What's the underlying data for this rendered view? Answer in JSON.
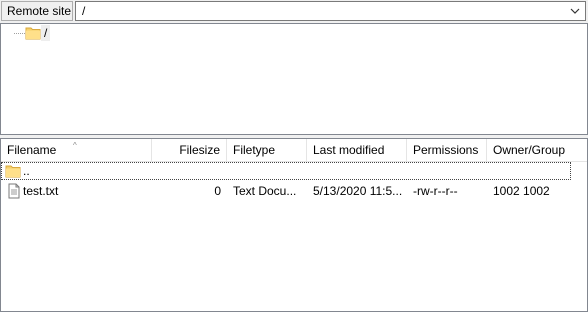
{
  "site_bar": {
    "label": "Remote site:",
    "path": "/"
  },
  "tree": {
    "root_label": "/"
  },
  "file_list": {
    "columns": [
      {
        "key": "filename",
        "label": "Filename",
        "sorted": "asc"
      },
      {
        "key": "filesize",
        "label": "Filesize"
      },
      {
        "key": "filetype",
        "label": "Filetype"
      },
      {
        "key": "modified",
        "label": "Last modified"
      },
      {
        "key": "permissions",
        "label": "Permissions"
      },
      {
        "key": "owner",
        "label": "Owner/Group"
      }
    ],
    "parent_entry": {
      "name": ".."
    },
    "rows": [
      {
        "icon": "text-file-icon",
        "filename": "test.txt",
        "filesize": "0",
        "filetype": "Text Docu...",
        "modified": "5/13/2020 11:5...",
        "permissions": "-rw-r--r--",
        "owner": "1002 1002"
      }
    ]
  },
  "colors": {
    "folder": "#f5d06b",
    "border": "#828790",
    "toolbar_bg": "#f0f0f0"
  }
}
